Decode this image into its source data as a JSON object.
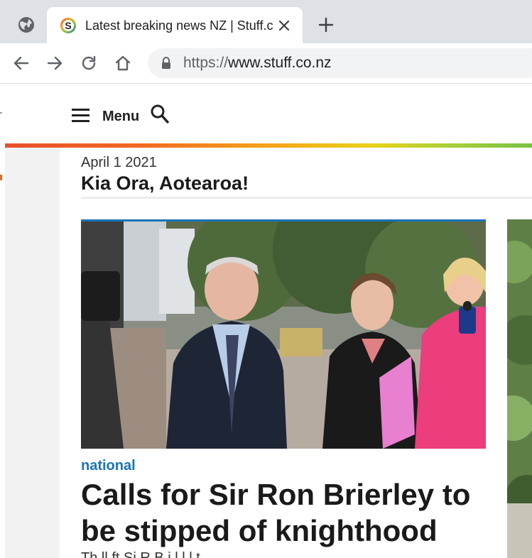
{
  "browser": {
    "tab": {
      "title": "Latest breaking news NZ | Stuff.co.nz",
      "favicon": "stuff-s-logo-icon"
    },
    "address": {
      "scheme": "https://",
      "host": "www.stuff.co.nz"
    },
    "icons": [
      "globe-icon",
      "close-icon",
      "plus-icon",
      "back-icon",
      "forward-icon",
      "reload-icon",
      "home-icon",
      "lock-icon"
    ]
  },
  "site": {
    "menu_label": "Menu",
    "date": "April 1 2021",
    "greeting": "Kia Ora, Aotearoa!",
    "accent_colors": {
      "brand_orange": "#f26722",
      "section_blue": "#1a73b8"
    }
  },
  "lead_story": {
    "section": "national",
    "headline": "Calls for Sir Ron Brierley to be stipped of knighthood",
    "teaser": "Th ll ft Si R B i l l l t"
  }
}
